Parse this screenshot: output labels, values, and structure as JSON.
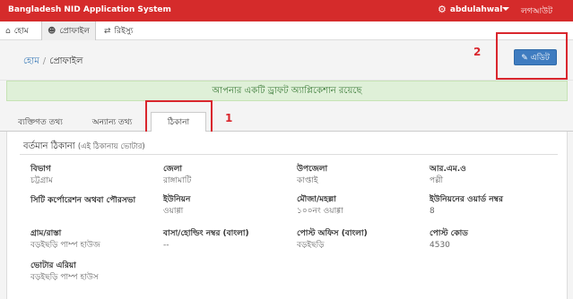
{
  "topbar": {
    "app_title": "Bangladesh NID Application System",
    "username": "abdulahwal",
    "logout_label": "লগআউট",
    "user_icon": "gear-icon"
  },
  "navtabs": [
    {
      "label": "হোম",
      "icon": "home-icon"
    },
    {
      "label": "প্রোফাইল",
      "icon": "user-icon"
    },
    {
      "label": "রিইস্যু",
      "icon": "reissue-icon"
    }
  ],
  "breadcrumb": {
    "home": "হোম",
    "separator": "/",
    "current": "প্রোফাইল"
  },
  "edit_button": {
    "label": "এডিট",
    "icon": "edit-icon"
  },
  "annotations": {
    "tab_marker": "1",
    "edit_marker": "2",
    "color": "#d9262d"
  },
  "alert": {
    "text": "আপনার একটি ড্রাফট অ্যাপ্লিকেশান রয়েছে"
  },
  "tabs": [
    {
      "label": "ব্যক্তিগত তথ্য"
    },
    {
      "label": "অন্যান্য তথ্য"
    },
    {
      "label": "ঠিকানা"
    }
  ],
  "section": {
    "title": "বর্তমান ঠিকানা",
    "note": "(এই ঠিকানায় ভোটার)"
  },
  "fields": [
    {
      "label": "বিভাগ",
      "value": "চট্টগ্রাম"
    },
    {
      "label": "জেলা",
      "value": "রাঙ্গামাটি"
    },
    {
      "label": "উপজেলা",
      "value": "কাপ্তাই"
    },
    {
      "label": "আর.এম.ও",
      "value": "পল্লী"
    },
    {
      "label": "সিটি কর্পোরেশন অথবা পৌরসভা",
      "value": ""
    },
    {
      "label": "ইউনিয়ন",
      "value": "ওয়াগ্গা"
    },
    {
      "label": "মৌজা/মহল্লা",
      "value": "১০০নং ওয়াগ্গা"
    },
    {
      "label": "ইউনিয়নের ওয়ার্ড নম্বর",
      "value": "8"
    },
    {
      "label": "গ্রাম/রাস্তা",
      "value": "বড়ইছড়ি পাম্প হাউজ"
    },
    {
      "label": "বাসা/হোল্ডিং নম্বর (বাংলা)",
      "value": "--"
    },
    {
      "label": "পোস্ট অফিস (বাংলা)",
      "value": "বড়ইছড়ি"
    },
    {
      "label": "পোস্ট কোড",
      "value": "4530"
    },
    {
      "label": "ভোটার এরিয়া",
      "value": "বড়ইছড়ি পাম্প হাউস"
    }
  ],
  "colors": {
    "topbar": "#d52b2b",
    "primary_button": "#3f7cc0",
    "alert_bg": "#dff0d8",
    "alert_text": "#3a7a37"
  }
}
